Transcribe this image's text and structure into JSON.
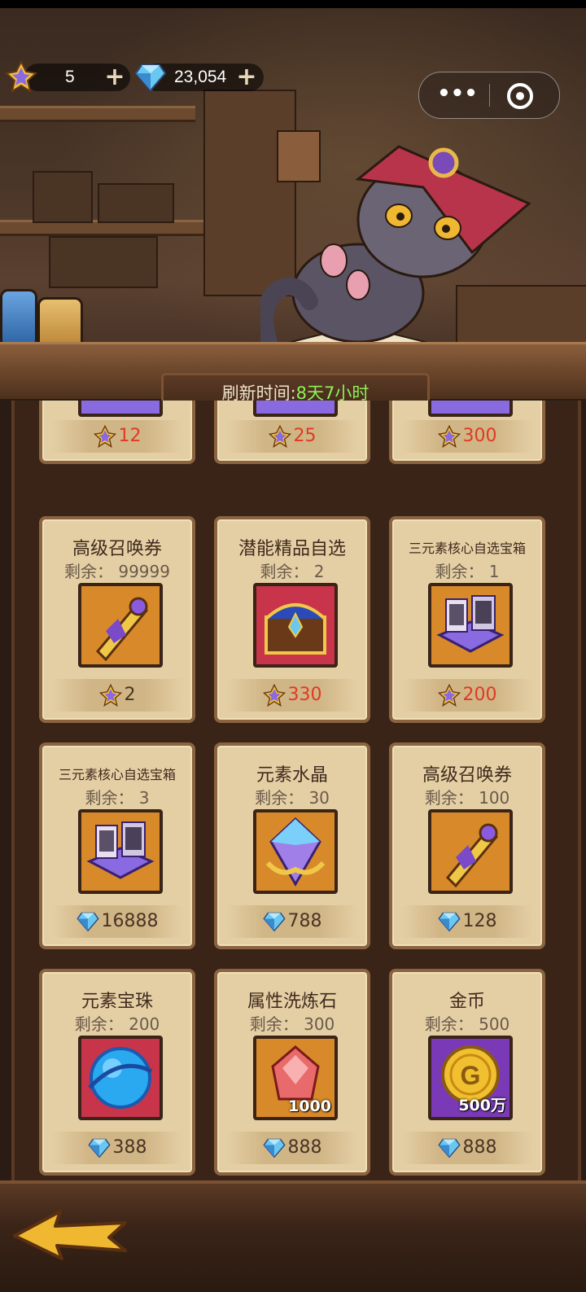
{
  "currency": {
    "ticket_value": "5",
    "diamond_value": "23,054"
  },
  "refresh": {
    "label": "刷新时间:",
    "time": "8天7小时"
  },
  "shop": {
    "partial_row": [
      {
        "price": "12",
        "currency": "ticket",
        "price_color": "red"
      },
      {
        "price": "25",
        "currency": "ticket",
        "price_color": "red"
      },
      {
        "price": "300",
        "currency": "ticket",
        "price_color": "red"
      }
    ],
    "items": [
      {
        "name": "高级召唤券",
        "remain": "剩余：  99999",
        "price": "2",
        "currency": "ticket",
        "price_color": "dark",
        "icon": "summon-scroll-icon",
        "qty": ""
      },
      {
        "name": "潜能精品自选",
        "remain": "剩余：  2",
        "price": "330",
        "currency": "ticket",
        "price_color": "red",
        "icon": "treasure-chest-icon",
        "qty": ""
      },
      {
        "name": "三元素核心自选宝箱",
        "remain": "剩余：  1",
        "price": "200",
        "currency": "ticket",
        "price_color": "red",
        "icon": "card-box-icon",
        "qty": ""
      },
      {
        "name": "三元素核心自选宝箱",
        "remain": "剩余：  3",
        "price": "16888",
        "currency": "diamond",
        "price_color": "dark",
        "icon": "card-box-icon",
        "qty": ""
      },
      {
        "name": "元素水晶",
        "remain": "剩余：  30",
        "price": "788",
        "currency": "diamond",
        "price_color": "dark",
        "icon": "element-crystal-icon",
        "qty": ""
      },
      {
        "name": "高级召唤券",
        "remain": "剩余：  100",
        "price": "128",
        "currency": "diamond",
        "price_color": "dark",
        "icon": "summon-scroll-icon",
        "qty": ""
      },
      {
        "name": "元素宝珠",
        "remain": "剩余：  200",
        "price": "388",
        "currency": "diamond",
        "price_color": "dark",
        "icon": "element-orb-icon",
        "qty": ""
      },
      {
        "name": "属性洗炼石",
        "remain": "剩余：  300",
        "price": "888",
        "currency": "diamond",
        "price_color": "dark",
        "icon": "refining-stone-icon",
        "qty": "1000"
      },
      {
        "name": "金币",
        "remain": "剩余：  500",
        "price": "888",
        "currency": "diamond",
        "price_color": "dark",
        "icon": "gold-coin-icon",
        "qty": "500万"
      }
    ]
  },
  "colors": {
    "card_bg": "#e4cfa5",
    "price_red": "#e03a24",
    "refresh_green": "#8ef05a"
  }
}
